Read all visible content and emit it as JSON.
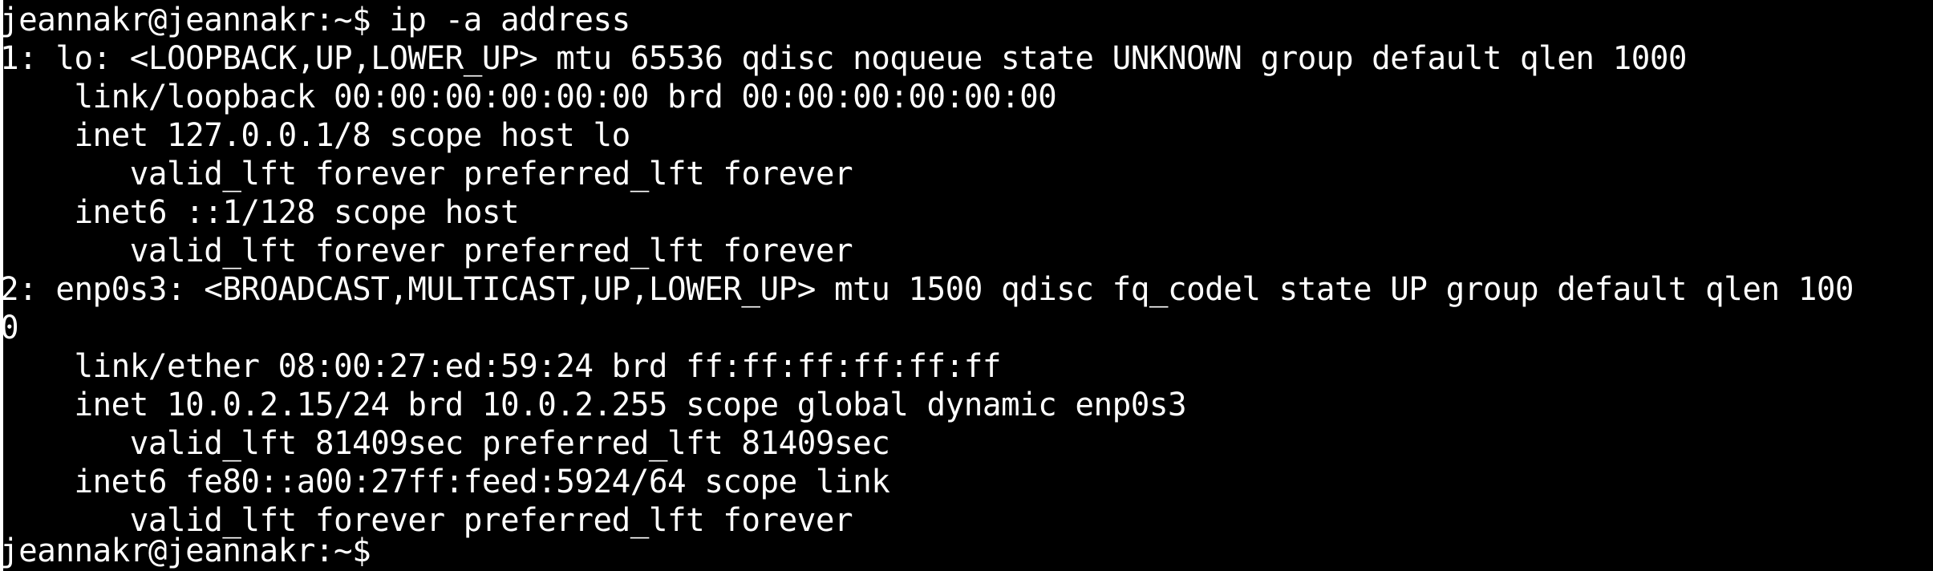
{
  "terminal": {
    "background": "#000000",
    "foreground": "#ffffff",
    "lines": [
      "jeannakr@jeannakr:~$ ip -a address",
      "1: lo: <LOOPBACK,UP,LOWER_UP> mtu 65536 qdisc noqueue state UNKNOWN group default qlen 1000",
      "    link/loopback 00:00:00:00:00:00 brd 00:00:00:00:00:00",
      "    inet 127.0.0.1/8 scope host lo",
      "       valid_lft forever preferred_lft forever",
      "    inet6 ::1/128 scope host",
      "       valid_lft forever preferred_lft forever",
      "2: enp0s3: <BROADCAST,MULTICAST,UP,LOWER_UP> mtu 1500 qdisc fq_codel state UP group default qlen 100",
      "0",
      "    link/ether 08:00:27:ed:59:24 brd ff:ff:ff:ff:ff:ff",
      "    inet 10.0.2.15/24 brd 10.0.2.255 scope global dynamic enp0s3",
      "       valid_lft 81409sec preferred_lft 81409sec",
      "    inet6 fe80::a00:27ff:feed:5924/64 scope link",
      "       valid_lft forever preferred_lft forever",
      "jeannakr@jeannakr:~$"
    ]
  }
}
